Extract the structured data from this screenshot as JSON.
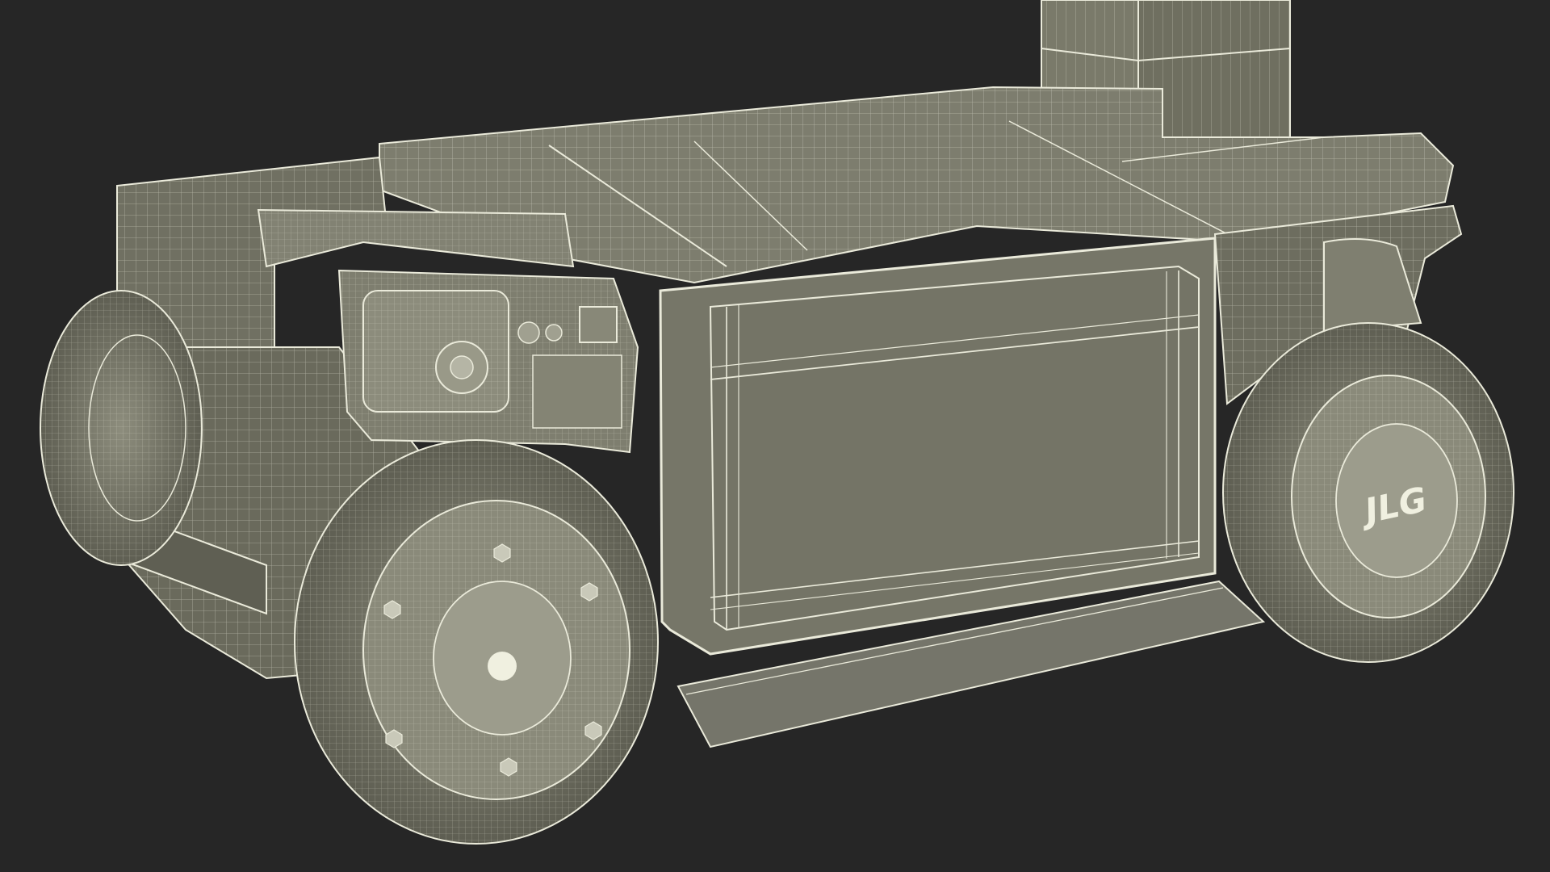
{
  "scene": {
    "subject": "wireframe-lift-base-render",
    "background_color": "#262626",
    "body_color": "#787868",
    "body_shadow_color": "#5f5f53",
    "body_light_color": "#8a8a7a",
    "wire_color": "#e8e8d8",
    "wheel_hub_color": "#d8d8c8"
  },
  "logo": {
    "text": "JLG"
  }
}
